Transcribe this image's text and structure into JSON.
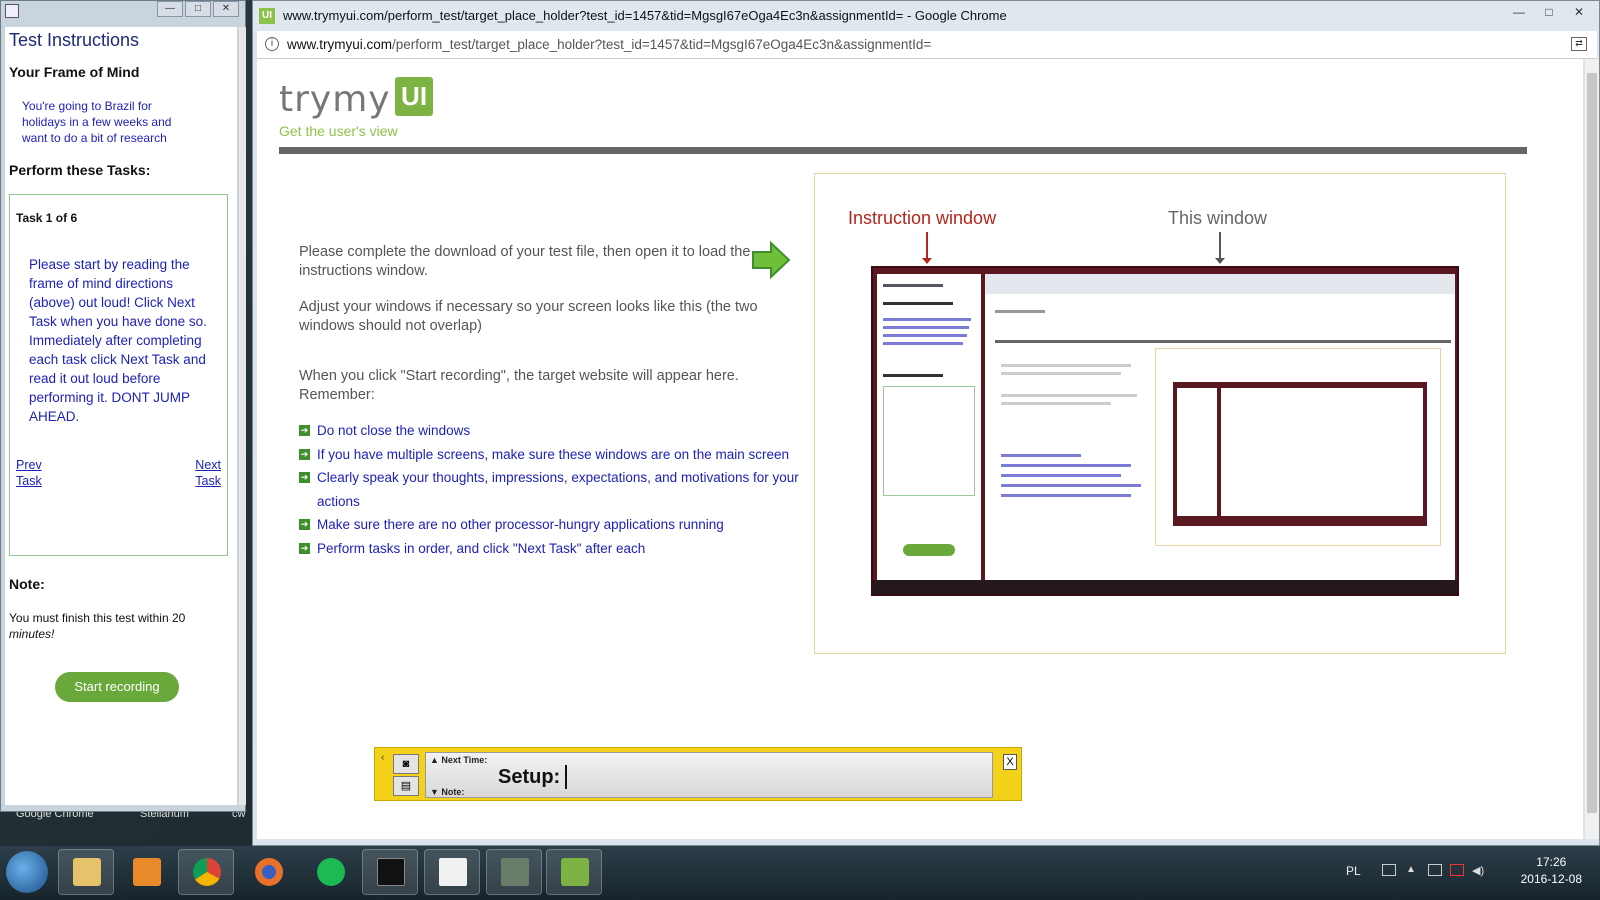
{
  "desktop": {
    "labels": [
      "Google Chrome",
      "Stellarium",
      "cw"
    ]
  },
  "instruction_window": {
    "controls": [
      "—",
      "□",
      "✕"
    ],
    "title": "Test Instructions",
    "frame_heading": "Your Frame of Mind",
    "frame_text": "You're going to Brazil for holidays in a few weeks and want to do a bit of research",
    "tasks_heading": "Perform these Tasks:",
    "task_counter": "Task 1 of 6",
    "task_text": "Please start by reading the frame of mind directions (above) out loud! Click Next Task when you have done so. Immediately after completing each task click Next Task and read it out loud before performing it. DONT JUMP AHEAD.",
    "prev_task": "Prev Task",
    "next_task": "Next Task",
    "note_heading": "Note:",
    "note_text": "You must finish this test within 20",
    "note_unit": "minutes!",
    "start_button": "Start recording"
  },
  "chrome": {
    "favicon": "UI",
    "title": "www.trymyui.com/perform_test/target_place_holder?test_id=1457&tid=MgsgI67eOga4Ec3n&assignmentId= - Google Chrome",
    "controls": [
      "—",
      "□",
      "✕"
    ],
    "url_host": "www.trymyui.com",
    "url_path": "/perform_test/target_place_holder?test_id=1457&tid=MgsgI67eOga4Ec3n&assignmentId="
  },
  "page": {
    "logo_try": "trymy",
    "logo_ui": "UI",
    "tagline": "Get the user's view",
    "para1": "Please complete the download of your test file, then open it to load the instructions window.",
    "para2": "Adjust your windows if necessary so your screen looks like this (the two windows should not overlap)",
    "para3": "When you click \"Start recording\", the target website will appear here. Remember:",
    "rules": [
      "Do not close the windows",
      "If you have multiple screens, make sure these windows are on the main screen",
      "Clearly speak your thoughts, impressions, expectations, and motivations for your actions",
      "Make sure there are no other processor-hungry applications running",
      "Perform tasks in order, and click \"Next Task\" after each"
    ],
    "demo_instruction_label": "Instruction window",
    "demo_this_label": "This window"
  },
  "capture_toolbar": {
    "next_time_label": "▲ Next Time:",
    "note_label": "▼ Note:",
    "setup_label": "Setup:",
    "close_label": "X"
  },
  "taskbar": {
    "apps": [
      "windows-explorer",
      "media-player",
      "chrome",
      "firefox",
      "spotify",
      "command-prompt",
      "notepad",
      "screen-recorder",
      "trymyui"
    ],
    "lang": "PL",
    "time": "17:26",
    "date": "2016-12-08"
  },
  "colors": {
    "brand_green": "#7cb342",
    "link_blue": "#1e22b8",
    "capture_yellow": "#f5d21a"
  }
}
